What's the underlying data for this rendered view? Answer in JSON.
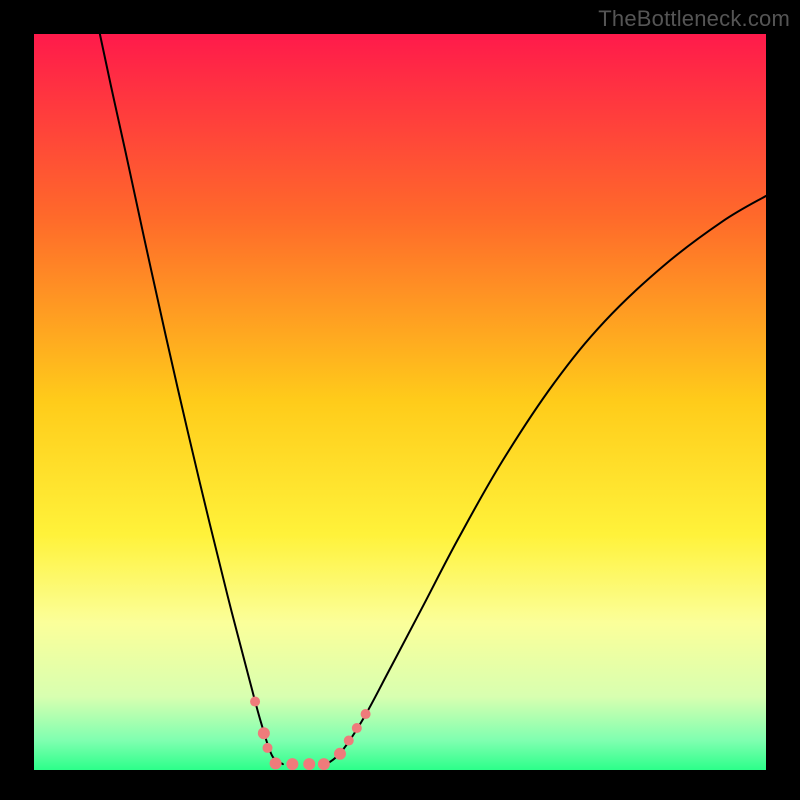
{
  "watermark": "TheBottleneck.com",
  "chart_data": {
    "type": "line",
    "title": "",
    "xlabel": "",
    "ylabel": "",
    "xlim": [
      0,
      100
    ],
    "ylim": [
      0,
      100
    ],
    "grid": false,
    "legend": false,
    "gradient_stops": [
      {
        "offset": 0,
        "color": "#ff1a4b"
      },
      {
        "offset": 0.25,
        "color": "#ff6a2a"
      },
      {
        "offset": 0.5,
        "color": "#ffcc1a"
      },
      {
        "offset": 0.68,
        "color": "#fff23a"
      },
      {
        "offset": 0.8,
        "color": "#fbff9a"
      },
      {
        "offset": 0.9,
        "color": "#d8ffb0"
      },
      {
        "offset": 0.96,
        "color": "#7fffb0"
      },
      {
        "offset": 1.0,
        "color": "#2cff8a"
      }
    ],
    "series": [
      {
        "name": "left-curve",
        "stroke": "#000",
        "points": [
          {
            "x": 9.0,
            "y": 100.0
          },
          {
            "x": 10.5,
            "y": 93.0
          },
          {
            "x": 12.5,
            "y": 84.0
          },
          {
            "x": 15.0,
            "y": 72.5
          },
          {
            "x": 18.0,
            "y": 59.0
          },
          {
            "x": 21.0,
            "y": 46.0
          },
          {
            "x": 24.0,
            "y": 33.5
          },
          {
            "x": 27.0,
            "y": 21.5
          },
          {
            "x": 29.5,
            "y": 12.0
          },
          {
            "x": 31.0,
            "y": 6.5
          },
          {
            "x": 32.5,
            "y": 2.0
          },
          {
            "x": 34.0,
            "y": 0.8
          }
        ]
      },
      {
        "name": "right-curve",
        "stroke": "#000",
        "points": [
          {
            "x": 40.0,
            "y": 0.8
          },
          {
            "x": 42.0,
            "y": 2.5
          },
          {
            "x": 45.0,
            "y": 7.0
          },
          {
            "x": 48.5,
            "y": 13.5
          },
          {
            "x": 53.0,
            "y": 22.0
          },
          {
            "x": 58.0,
            "y": 31.5
          },
          {
            "x": 64.0,
            "y": 42.0
          },
          {
            "x": 71.0,
            "y": 52.5
          },
          {
            "x": 78.0,
            "y": 61.0
          },
          {
            "x": 86.0,
            "y": 68.5
          },
          {
            "x": 94.0,
            "y": 74.5
          },
          {
            "x": 100.0,
            "y": 78.0
          }
        ]
      }
    ],
    "markers": [
      {
        "x": 30.2,
        "y": 9.3,
        "r": 5
      },
      {
        "x": 31.4,
        "y": 5.0,
        "r": 6
      },
      {
        "x": 31.9,
        "y": 3.0,
        "r": 5
      },
      {
        "x": 33.0,
        "y": 0.9,
        "r": 6
      },
      {
        "x": 35.3,
        "y": 0.8,
        "r": 6
      },
      {
        "x": 37.6,
        "y": 0.8,
        "r": 6
      },
      {
        "x": 39.6,
        "y": 0.8,
        "r": 6
      },
      {
        "x": 41.8,
        "y": 2.2,
        "r": 6
      },
      {
        "x": 43.0,
        "y": 4.0,
        "r": 5
      },
      {
        "x": 44.1,
        "y": 5.7,
        "r": 5
      },
      {
        "x": 45.3,
        "y": 7.6,
        "r": 5
      }
    ],
    "marker_color": "#ef7b7b"
  }
}
